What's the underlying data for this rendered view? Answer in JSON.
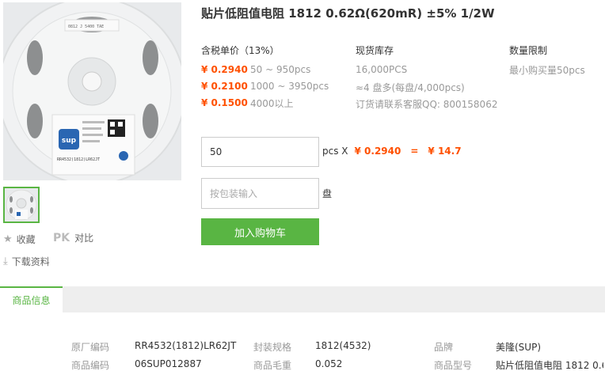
{
  "product": {
    "title": "贴片低阻值电阻 1812 0.62Ω(620mR) ±5% 1/2W",
    "image_brand": "sup",
    "reel_label": "RR4532(1812)LR62JT",
    "reel_label_top": "0812 J 5400 TAE"
  },
  "sidebar": {
    "collect_label": "收藏",
    "pk_label": "PK",
    "compare_label": "对比",
    "download_label": "下载资料"
  },
  "pricing": {
    "header_price": "含税单价（13%）",
    "header_stock": "现货库存",
    "header_limit": "数量限制",
    "tiers": [
      {
        "price": "¥ 0.2940",
        "qty": "50 ~ 950pcs"
      },
      {
        "price": "¥ 0.2100",
        "qty": "1000 ~ 3950pcs"
      },
      {
        "price": "¥ 0.1500",
        "qty": "4000以上"
      }
    ],
    "stock_lines": [
      "16,000PCS",
      "≈4 盘多(每盘/4,000pcs)",
      "订货请联系客服QQ: 800158062"
    ],
    "limit_text": "最小购买量50pcs"
  },
  "order": {
    "quantity_value": "50",
    "unit_label": "pcs X",
    "unit_price": "¥ 0.2940",
    "equals": "=",
    "total": "¥ 14.7",
    "reel_placeholder": "按包装输入",
    "reel_unit": "盘",
    "add_cart_label": "加入购物车"
  },
  "info": {
    "tab_label": "商品信息",
    "attributes": [
      {
        "key": "原厂编码",
        "value": "RR4532(1812)LR62JT"
      },
      {
        "key": "封装规格",
        "value": "1812(4532)"
      },
      {
        "key": "品牌",
        "value": "美隆(SUP)"
      },
      {
        "key": "商品编码",
        "value": "06SUP012887"
      },
      {
        "key": "商品毛重",
        "value": "0.052"
      },
      {
        "key": "商品型号",
        "value": "贴片低阻值电阻 1812 0.6."
      }
    ]
  },
  "colors": {
    "accent_green": "#59b543",
    "price_orange": "#ff5000"
  }
}
